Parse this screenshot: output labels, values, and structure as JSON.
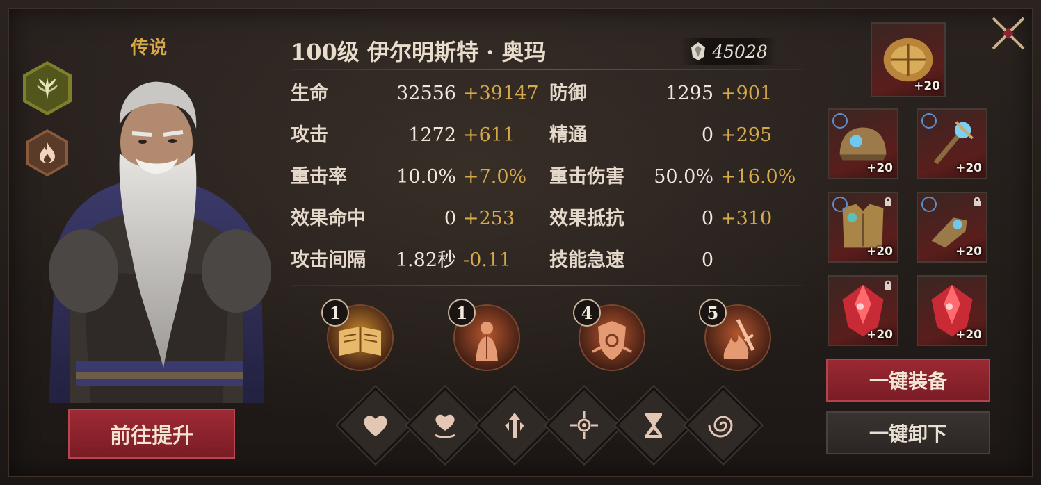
{
  "hero": {
    "rarity": "传说",
    "name": "100级  伊尔明斯特 · 奥玛",
    "power": "45028",
    "upgrade_label": "前往提升"
  },
  "stats": [
    {
      "label": "生命",
      "base": "32556",
      "bonus": "+39147"
    },
    {
      "label": "防御",
      "base": "1295",
      "bonus": "+901"
    },
    {
      "label": "攻击",
      "base": "1272",
      "bonus": "+611"
    },
    {
      "label": "精通",
      "base": "0",
      "bonus": "+295"
    },
    {
      "label": "重击率",
      "base": "10.0%",
      "bonus": "+7.0%"
    },
    {
      "label": "重击伤害",
      "base": "50.0%",
      "bonus": "+16.0%"
    },
    {
      "label": "效果命中",
      "base": "0",
      "bonus": "+253"
    },
    {
      "label": "效果抵抗",
      "base": "0",
      "bonus": "+310"
    },
    {
      "label": "攻击间隔",
      "base": "1.82秒",
      "bonus": "-0.11"
    },
    {
      "label": "技能急速",
      "base": "0",
      "bonus": ""
    }
  ],
  "skills": [
    {
      "level": "1",
      "icon": "spellbook-icon",
      "color": "#c98a2e"
    },
    {
      "level": "1",
      "icon": "wizard-figure-icon",
      "color": "#b4562e"
    },
    {
      "level": "4",
      "icon": "shield-chain-icon",
      "color": "#b4562e"
    },
    {
      "level": "5",
      "icon": "fire-sword-icon",
      "color": "#b4562e"
    }
  ],
  "runes": [
    {
      "icon": "heart-icon"
    },
    {
      "icon": "heart-heal-icon"
    },
    {
      "icon": "sword-up-icon"
    },
    {
      "icon": "crosshair-icon"
    },
    {
      "icon": "hourglass-icon"
    },
    {
      "icon": "swirl-icon"
    }
  ],
  "equipment": [
    {
      "slot": "artifact",
      "level": "+20",
      "icon": "golden-relic-icon"
    },
    {
      "slot": "helm",
      "level": "+20",
      "icon": "helmet-icon"
    },
    {
      "slot": "weapon",
      "level": "+20",
      "icon": "staff-icon"
    },
    {
      "slot": "armor",
      "level": "+20",
      "icon": "chest-armor-icon"
    },
    {
      "slot": "gloves",
      "level": "+20",
      "icon": "gauntlet-icon"
    },
    {
      "slot": "gem-1",
      "level": "+20",
      "icon": "red-gem-icon"
    },
    {
      "slot": "gem-2",
      "level": "+20",
      "icon": "red-gem-icon"
    }
  ],
  "buttons": {
    "equip_all": "一键装备",
    "unequip_all": "一键卸下"
  },
  "colors": {
    "gold_text": "#d6a94a",
    "red_button": "#8c2330"
  }
}
